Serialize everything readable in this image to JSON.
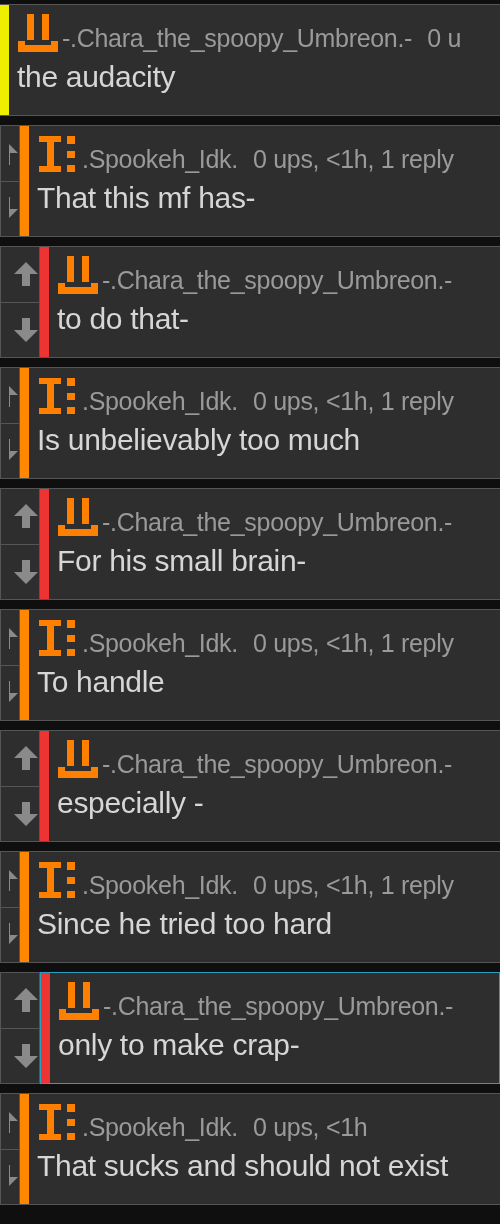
{
  "comments": [
    {
      "username": "-.Chara_the_spoopy_Umbreon.-",
      "meta": "0 u",
      "text": "the audacity",
      "kind": "tray",
      "color": "#eeee00",
      "vote_buttons": false,
      "highlighted": false
    },
    {
      "username": ".Spookeh_Idk.",
      "meta": "0 ups, <1h, 1 reply",
      "text": "That this mf has-",
      "kind": "bracket",
      "color": "#ff8800",
      "vote_buttons": true,
      "highlighted": false
    },
    {
      "username": "-.Chara_the_spoopy_Umbreon.-",
      "text": "to do that-",
      "kind": "tray",
      "color": "#ee3333",
      "vote_buttons": true,
      "highlighted": false
    },
    {
      "username": ".Spookeh_Idk.",
      "meta": "0 ups, <1h, 1 reply",
      "text": "Is unbelievably too much",
      "kind": "bracket",
      "color": "#ff8800",
      "vote_buttons": true,
      "highlighted": false
    },
    {
      "username": "-.Chara_the_spoopy_Umbreon.-",
      "text": "For his small brain-",
      "kind": "tray",
      "color": "#ee3333",
      "vote_buttons": true,
      "highlighted": false
    },
    {
      "username": ".Spookeh_Idk.",
      "meta": "0 ups, <1h, 1 reply",
      "text": "To handle",
      "kind": "bracket",
      "color": "#ff8800",
      "vote_buttons": true,
      "highlighted": false
    },
    {
      "username": "-.Chara_the_spoopy_Umbreon.-",
      "text": "especially -",
      "kind": "tray",
      "color": "#ee3333",
      "vote_buttons": true,
      "highlighted": false
    },
    {
      "username": ".Spookeh_Idk.",
      "meta": "0 ups, <1h, 1 reply",
      "text": "Since he tried too hard",
      "kind": "bracket",
      "color": "#ff8800",
      "vote_buttons": true,
      "highlighted": false
    },
    {
      "username": "-.Chara_the_spoopy_Umbreon.-",
      "text": "only to make crap-",
      "kind": "tray",
      "color": "#ee3333",
      "vote_buttons": true,
      "highlighted": true
    },
    {
      "username": ".Spookeh_Idk.",
      "meta": "0 ups, <1h",
      "text": "That sucks and should not exist",
      "kind": "bracket",
      "color": "#ff8800",
      "vote_buttons": true,
      "highlighted": false
    }
  ]
}
